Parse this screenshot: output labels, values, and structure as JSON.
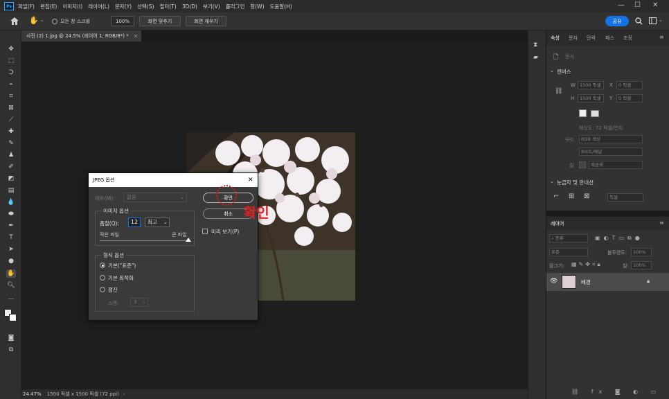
{
  "menubar": {
    "logo": "Ps",
    "items": [
      "파일(F)",
      "편집(E)",
      "이미지(I)",
      "레이어(L)",
      "문자(Y)",
      "선택(S)",
      "필터(T)",
      "3D(D)",
      "보기(V)",
      "플러그인",
      "창(W)",
      "도움말(H)"
    ],
    "minimize": "—",
    "maximize": "☐",
    "close": "✕"
  },
  "optbar": {
    "scroll_all_label": "모든 창 스크롤",
    "zoom_value": "100%",
    "fit_screen_label": "화면 맞추기",
    "fill_screen_label": "화면 채우기",
    "share_label": "공유"
  },
  "document": {
    "tab_title": "사진 (2) 1.jpg @ 24.5% (레이어 1, RGB/8*) *",
    "zoom": "24.47%",
    "info": "1500 픽셀 x 1500 픽셀 (72 ppi)"
  },
  "properties": {
    "tabs": [
      "속성",
      "문자",
      "단락",
      "패스",
      "조정"
    ],
    "doc_label": "문서",
    "canvas_title": "캔버스",
    "w_label": "W",
    "w_value": "1500 픽셀",
    "h_label": "H",
    "h_value": "1500 픽셀",
    "x_label": "X",
    "x_value": "0 픽셀",
    "y_label": "Y",
    "y_value": "0 픽셀",
    "resolution": "해상도: 72 픽셀/인치",
    "mode_label": "모드",
    "mode_value": "RGB 색상",
    "depth_value": "8비트/채널",
    "fill_label": "칠",
    "fill_value": "배경색",
    "rulers_title": "눈금자 및 안내선",
    "unit_value": "픽셀"
  },
  "layers": {
    "title": "레이어",
    "filter_label": "종류",
    "blend_mode": "표준",
    "opacity_label": "불투명도:",
    "opacity_value": "100%",
    "lock_label": "잠그기:",
    "fill_label": "칠:",
    "fill_value": "100%",
    "layer_name": "배경"
  },
  "dialog": {
    "title": "JPEG 옵션",
    "matte_label": "매트(M):",
    "matte_value": "없음",
    "ok_label": "확인",
    "cancel_label": "취소",
    "preview_label": "미리 보기(P)",
    "image_options_title": "이미지 옵션",
    "quality_label": "품질(Q):",
    "quality_value": "12",
    "quality_preset": "최고",
    "small_file_label": "작은 파일",
    "large_file_label": "큰 파일",
    "format_options_title": "형식 옵션",
    "format_baseline_standard": "기본(\"표준\")",
    "format_baseline_optimized": "기본 최적화",
    "format_progressive": "점진",
    "scan_label": "스캔:",
    "scan_value": "3",
    "selected_format": "baseline_standard",
    "quality_slider_fraction": 1.0
  },
  "annotation": {
    "text": "확인",
    "color": "#e0201e"
  }
}
